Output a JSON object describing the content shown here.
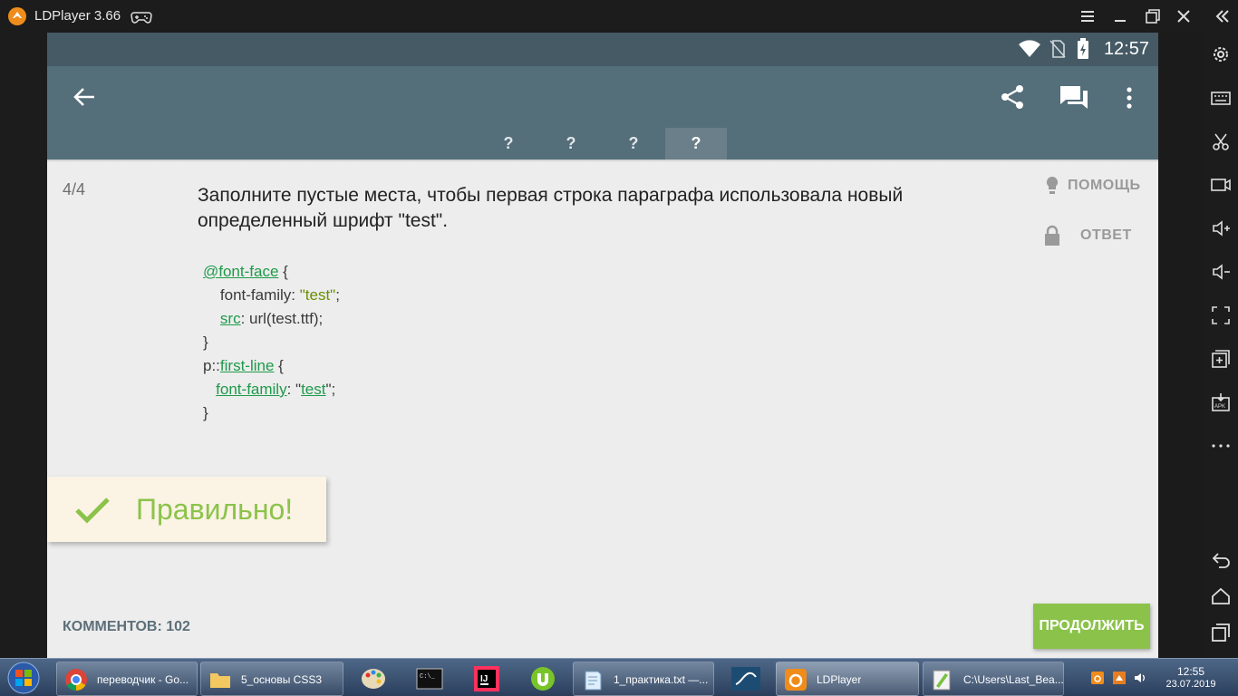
{
  "window": {
    "title": "LDPlayer 3.66"
  },
  "status": {
    "time": "12:57"
  },
  "tabs": [
    "?",
    "?",
    "?",
    "?"
  ],
  "question": {
    "counter": "4/4",
    "text": "Заполните пустые места, чтобы первая строка параграфа использовала новый определенный шрифт \"test\".",
    "help_label": "ПОМОЩЬ",
    "answer_label": "ОТВЕТ"
  },
  "code": {
    "l1_kw": "@font-face",
    "l1_rest": " {",
    "l2_a": "    font-family: ",
    "l2_str": "\"test\"",
    "l2_end": ";",
    "l3_kw": "src",
    "l3_rest": ": url(test.ttf);",
    "l4": "}",
    "l5_a": "p::",
    "l5_kw": "first-line",
    "l5_rest": " {",
    "l6_kw": "font-family",
    "l6_mid": ": \"",
    "l6_str": "test",
    "l6_end": "\";",
    "l7": "}"
  },
  "result": {
    "label": "Правильно!"
  },
  "footer": {
    "comments": "КОММЕНТОВ: 102",
    "continue_label": "ПРОДОЛЖИТЬ"
  },
  "taskbar": {
    "items": [
      {
        "label": "переводчик - Go..."
      },
      {
        "label": "5_основы CSS3"
      },
      {
        "label": "1_практика.txt —..."
      },
      {
        "label": "LDPlayer"
      },
      {
        "label": "C:\\Users\\Last_Bea..."
      }
    ],
    "clock_time": "12:55",
    "clock_date": "23.07.2019"
  },
  "colors": {
    "status_bar": "#455a64",
    "app_bar": "#546e7a",
    "accent_green": "#8bc34a",
    "code_green": "#1e9a4a"
  }
}
